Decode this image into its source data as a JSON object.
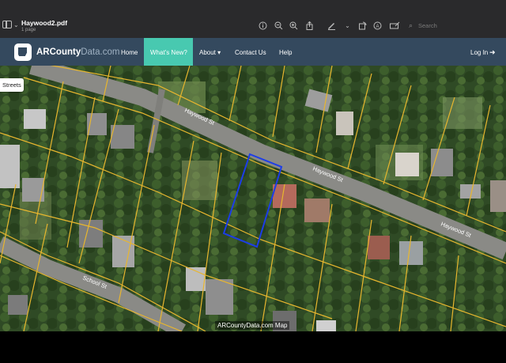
{
  "viewer": {
    "doc_title": "Haywood2.pdf",
    "doc_subtitle": "1 page",
    "search_placeholder": "Search",
    "icons": [
      "info-icon",
      "zoom-out-icon",
      "zoom-in-icon",
      "share-icon",
      "markup-pen-icon",
      "rotate-icon",
      "annotate-icon",
      "form-fill-icon",
      "search-icon"
    ]
  },
  "site": {
    "brand_main": "ARCounty",
    "brand_tail": "Data.com",
    "nav": [
      "Home",
      "What's New?",
      "About ▾",
      "Contact Us",
      "Help"
    ],
    "login": "Log In",
    "active_color": "#48c9b0",
    "bar_color": "#34495e"
  },
  "map": {
    "streets_button": "Streets",
    "credit": "ARCountyData.com Map",
    "street_labels": [
      "Haywood St",
      "Haywood St",
      "Haywood St",
      "School St"
    ],
    "parcel_line_color": "#e8b62e",
    "selected_parcel_color": "#1c3de8"
  }
}
